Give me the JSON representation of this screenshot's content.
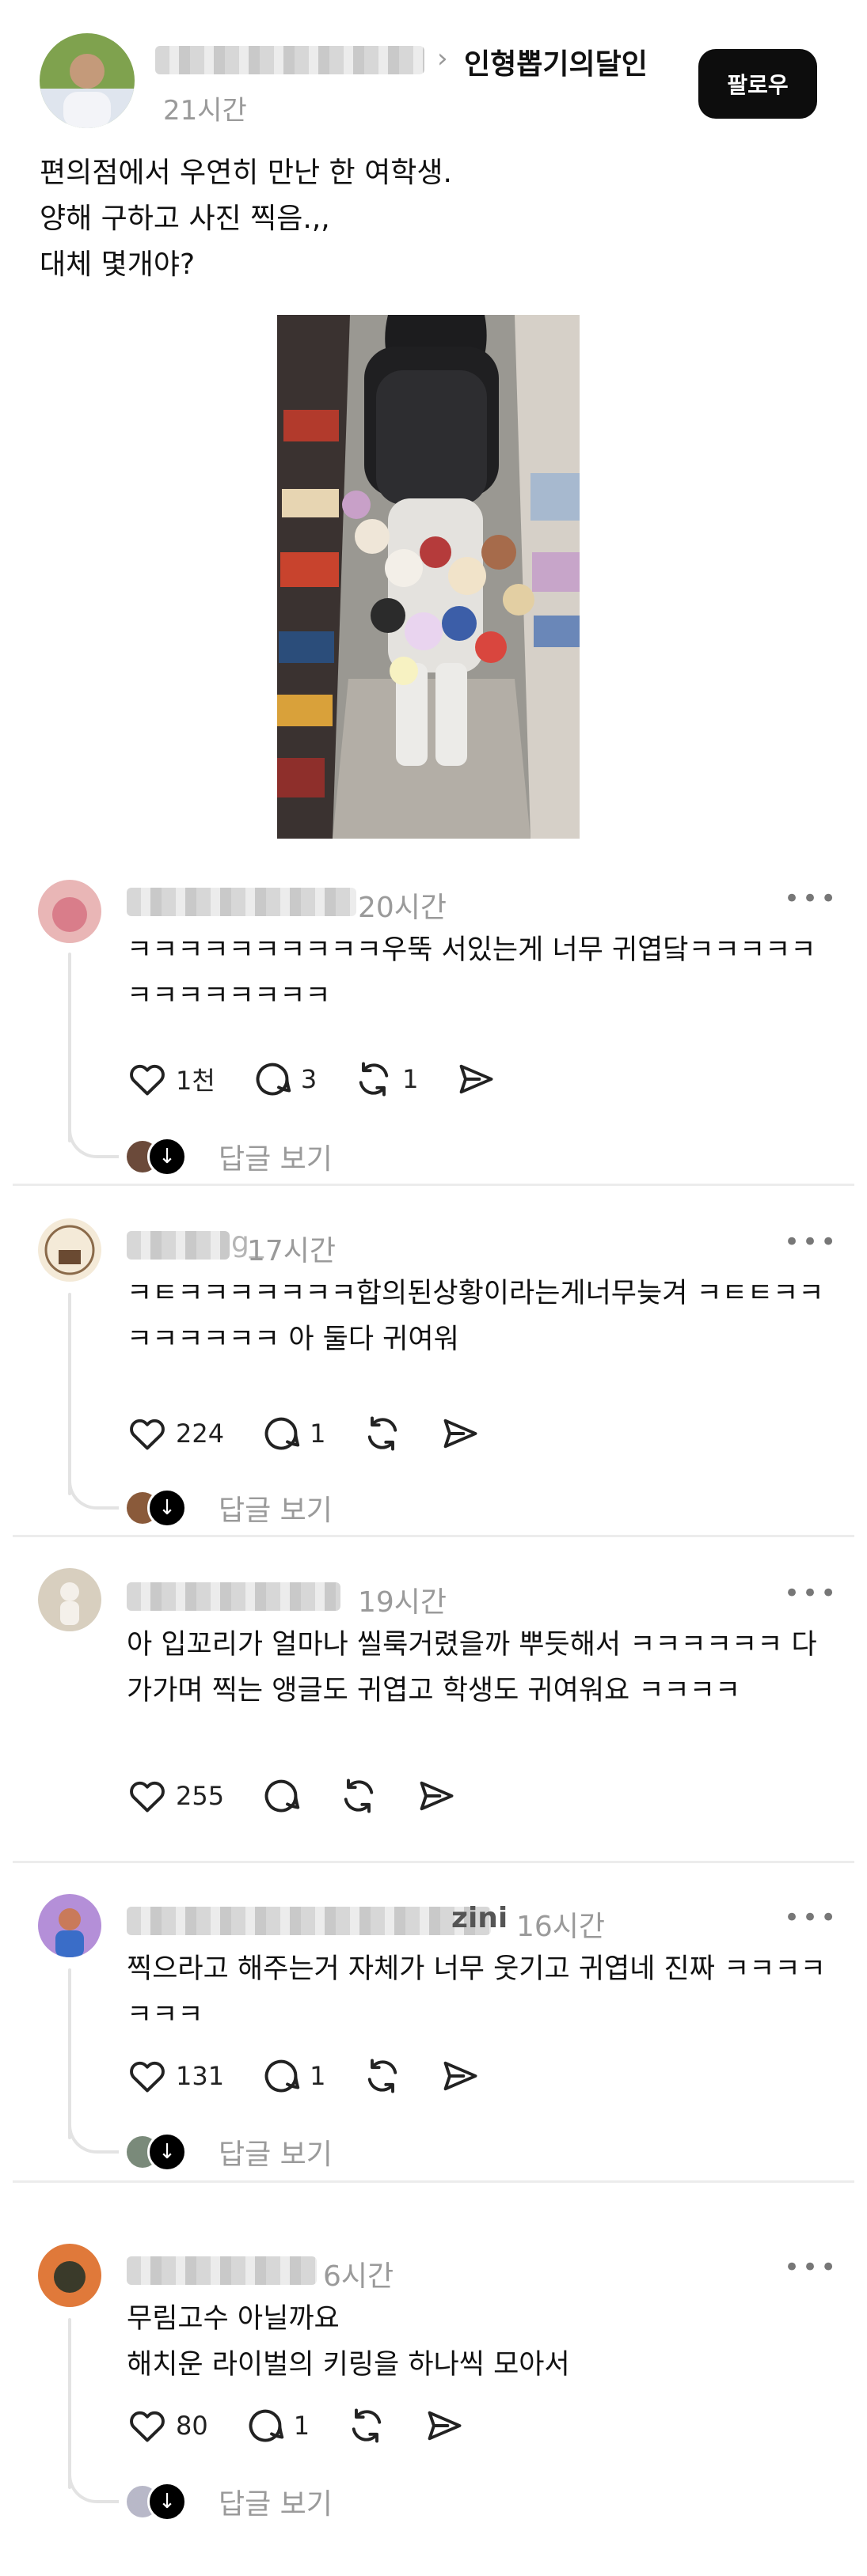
{
  "post": {
    "author_blurred": "ilgngu.ilm",
    "community": "인형뽑기의달인",
    "time": "21시간",
    "follow_label": "팔로우",
    "caption": [
      "편의점에서 우연히 만난 한 여학생.",
      "양해 구하고 사진 찍음.,,",
      "대체 몇개야?"
    ]
  },
  "comments": [
    {
      "time": "20시간",
      "text": "ㅋㅋㅋㅋㅋㅋㅋㅋㅋㅋ우뚝 서있는게 너무 귀엽닼ㅋㅋㅋㅋㅋㅋㅋㅋㅋㅋㅋㅋㅋ",
      "likes": "1천",
      "replies": "3",
      "reposts": "1",
      "view_replies": "답글 보기"
    },
    {
      "time": "17시간",
      "name_suffix": "g_",
      "text": "ㅋㅌㅋㅋㅋㅋㅋㅋㅋ합의된상황이라는게너무늦겨 ㅋㅌㅌㅋㅋㅋㅋㅋㅋㅋㅋ 아 둘다 귀여워",
      "likes": "224",
      "replies": "1",
      "reposts": "",
      "view_replies": "답글 보기"
    },
    {
      "time": "19시간",
      "text": "아 입꼬리가 얼마나 씰룩거렸을까 뿌듯해서 ㅋㅋㅋㅋㅋㅋ 다가가며 찍는 앵글도 귀엽고 학생도 귀여워요 ㅋㅋㅋㅋ",
      "likes": "255",
      "replies": "",
      "reposts": ""
    },
    {
      "time": "16시간",
      "name_suffix": "zini",
      "text": "찍으라고 해주는거 자체가 너무 웃기고 귀엽네 진짜 ㅋㅋㅋㅋㅋㅋㅋ",
      "likes": "131",
      "replies": "1",
      "reposts": "",
      "view_replies": "답글 보기"
    },
    {
      "time": "6시간",
      "text_lines": [
        "무림고수 아닐까요",
        "해치운 라이벌의 키링을 하나씩 모아서"
      ],
      "likes": "80",
      "replies": "1",
      "reposts": "",
      "view_replies": "답글 보기"
    }
  ],
  "icons": [
    "heart-icon",
    "comment-icon",
    "repost-icon",
    "share-icon",
    "more-icon",
    "chevron-right-icon",
    "down-arrow-icon"
  ],
  "colors": {
    "follow_bg": "#0d0d0d",
    "muted_text": "#9a9a9a",
    "divider": "#ececec"
  }
}
